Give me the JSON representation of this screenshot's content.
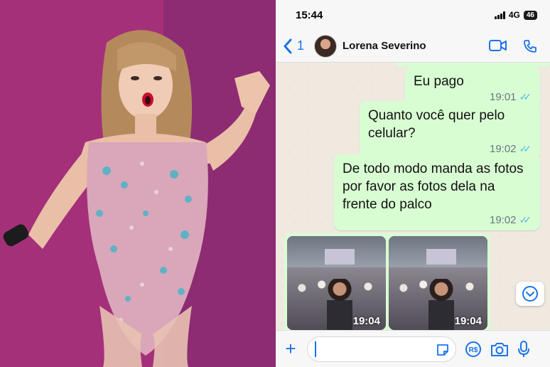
{
  "status_bar": {
    "time": "15:44",
    "network": "4G",
    "battery": "46"
  },
  "header": {
    "back_count": "1",
    "contact_name": "Lorena Severino"
  },
  "messages": [
    {
      "text": "Eu pago",
      "time": "19:01"
    },
    {
      "text": "Quanto você quer pelo celular?",
      "time": "19:02"
    },
    {
      "text": "De todo modo manda as fotos por favor as fotos dela na frente do palco",
      "time": "19:02"
    }
  ],
  "images": [
    {
      "time": "19:04"
    },
    {
      "time": "19:04"
    }
  ],
  "composer": {
    "value": ""
  },
  "colors": {
    "outgoing_bubble": "#d9fdd3",
    "accent": "#1a73e8",
    "read_ticks": "#53bdeb",
    "chat_bg": "#efe9e0"
  },
  "icons": [
    "chevron-left-icon",
    "video-call-icon",
    "phone-icon",
    "scroll-down-icon",
    "plus-icon",
    "sticker-icon",
    "payment-icon",
    "camera-icon",
    "microphone-icon"
  ]
}
